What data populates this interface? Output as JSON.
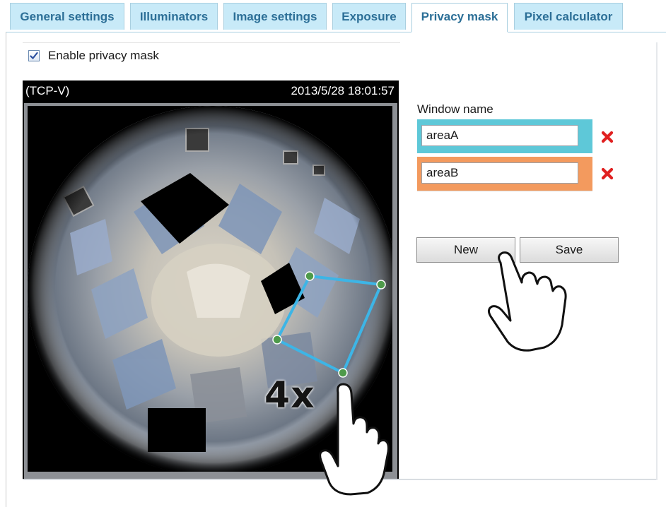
{
  "tabs": [
    {
      "label": "General settings",
      "active": false
    },
    {
      "label": "Illuminators",
      "active": false
    },
    {
      "label": "Image settings",
      "active": false
    },
    {
      "label": "Exposure",
      "active": false
    },
    {
      "label": "Privacy mask",
      "active": true
    },
    {
      "label": "Pixel calculator",
      "active": false
    }
  ],
  "privacy_mask": {
    "enable_label": "Enable privacy mask",
    "enabled": true
  },
  "video": {
    "camera_label": "(TCP-V)",
    "timestamp": "2013/5/28 18:01:57"
  },
  "window_list": {
    "title": "Window name",
    "items": [
      {
        "name": "areaA",
        "color": "#5ec8d8"
      },
      {
        "name": "areaB",
        "color": "#f39a5e"
      }
    ]
  },
  "buttons": {
    "new_label": "New",
    "save_label": "Save"
  },
  "annotation": {
    "zoom_text": "4x"
  },
  "colors": {
    "tab_bg": "#c8eaf8",
    "tab_text": "#2c6f97",
    "mask_outline": "#3db5e6",
    "mask_handle": "#4e9a4a",
    "delete": "#e02020"
  },
  "icons": {
    "checkbox": "checkbox-checked-icon",
    "delete": "delete-x-icon",
    "pointer_hand": "hand-pointer-icon"
  }
}
